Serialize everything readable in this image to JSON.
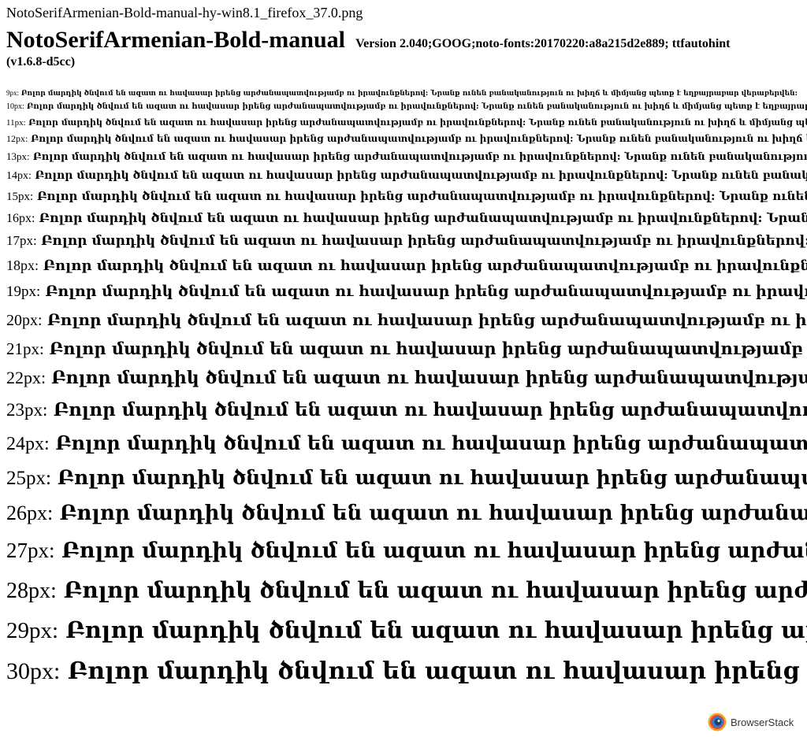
{
  "file_name": "NotoSerifArmenian-Bold-manual-hy-win8.1_firefox_37.0.png",
  "font_name": "NotoSerifArmenian-Bold-manual",
  "version": "Version 2.040;GOOG;noto-fonts:20170220:a8a215d2e889; ttfautohint",
  "version_tail": "(v1.6.8-d5cc)",
  "sample_text": "Բոլոր մարդիկ ծնվում են ազատ ու հավասար իրենց արժանապատվությամբ ու իրավունքներով: Նրանք ունեն բանականություն ու խիղճ և միմյանց պետք է եղբայրաբար վերաբերվեն:",
  "samples": [
    {
      "label": "9px:",
      "size": 9
    },
    {
      "label": "10px:",
      "size": 10
    },
    {
      "label": "11px:",
      "size": 11
    },
    {
      "label": "12px:",
      "size": 12
    },
    {
      "label": "13px:",
      "size": 13
    },
    {
      "label": "14px:",
      "size": 14
    },
    {
      "label": "15px:",
      "size": 15
    },
    {
      "label": "16px:",
      "size": 16
    },
    {
      "label": "17px:",
      "size": 17
    },
    {
      "label": "18px:",
      "size": 18
    },
    {
      "label": "19px:",
      "size": 19
    },
    {
      "label": "20px:",
      "size": 20
    },
    {
      "label": "21px:",
      "size": 21
    },
    {
      "label": "22px:",
      "size": 22
    },
    {
      "label": "23px:",
      "size": 23
    },
    {
      "label": "24px:",
      "size": 24
    },
    {
      "label": "25px:",
      "size": 25
    },
    {
      "label": "26px:",
      "size": 26
    },
    {
      "label": "27px:",
      "size": 27
    },
    {
      "label": "28px:",
      "size": 28
    },
    {
      "label": "29px:",
      "size": 29
    },
    {
      "label": "30px:",
      "size": 30
    }
  ],
  "badge": {
    "label": "BrowserStack",
    "icon": "browserstack-logo-icon"
  }
}
